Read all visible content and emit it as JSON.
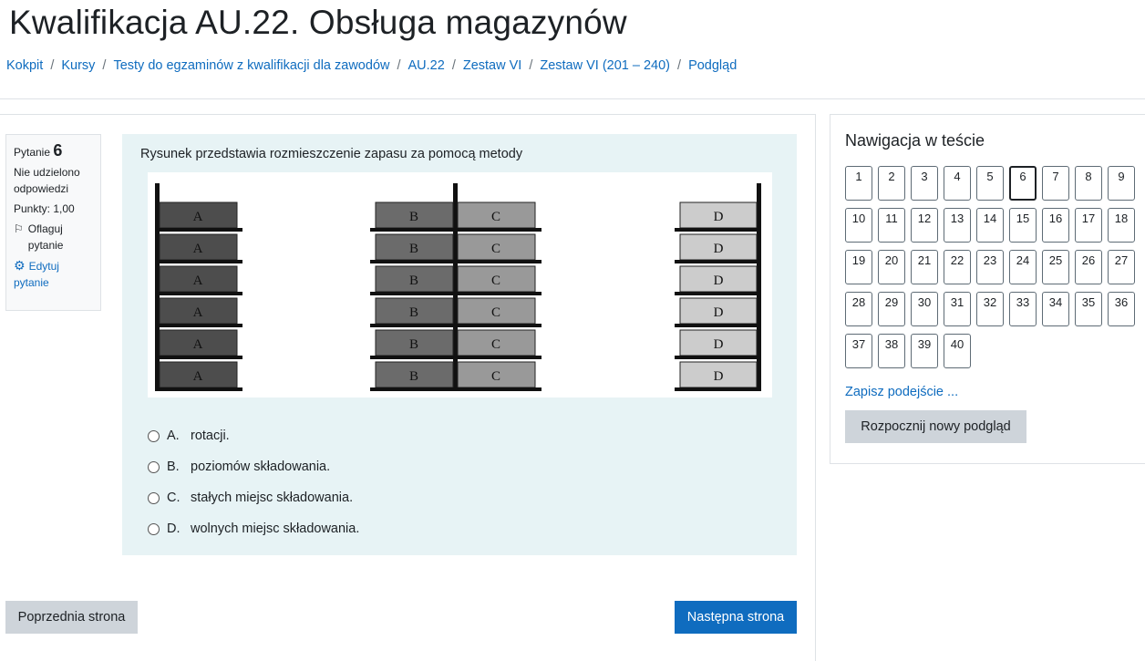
{
  "page": {
    "title": "Kwalifikacja AU.22. Obsługa magazynów"
  },
  "breadcrumb": [
    {
      "label": "Kokpit"
    },
    {
      "label": "Kursy"
    },
    {
      "label": "Testy do egzaminów z kwalifikacji dla zawodów"
    },
    {
      "label": "AU.22"
    },
    {
      "label": "Zestaw VI"
    },
    {
      "label": "Zestaw VI (201 – 240)"
    },
    {
      "label": "Podgląd"
    }
  ],
  "question_info": {
    "label": "Pytanie",
    "number": "6",
    "status": "Nie udzielono odpowiedzi",
    "points": "Punkty: 1,00",
    "flag_label": "Oflaguj pytanie",
    "edit_label": "Edytuj pytanie"
  },
  "question": {
    "text": "Rysunek przedstawia rozmieszczenie zapasu za pomocą metody",
    "image_labels": {
      "a": "A",
      "b": "B",
      "c": "C",
      "d": "D"
    },
    "image_colors": {
      "a": "#4d4d4d",
      "b": "#6b6b6b",
      "c": "#999999",
      "d": "#cccccc",
      "frame": "#111111"
    },
    "answers": [
      {
        "letter": "A.",
        "text": "rotacji."
      },
      {
        "letter": "B.",
        "text": "poziomów składowania."
      },
      {
        "letter": "C.",
        "text": "stałych miejsc składowania."
      },
      {
        "letter": "D.",
        "text": "wolnych miejsc składowania."
      }
    ]
  },
  "footer": {
    "prev_label": "Poprzednia strona",
    "next_label": "Następna strona"
  },
  "navigation": {
    "title": "Nawigacja w teście",
    "current": 6,
    "questions": [
      "1",
      "2",
      "3",
      "4",
      "5",
      "6",
      "7",
      "8",
      "9",
      "10",
      "11",
      "12",
      "13",
      "14",
      "15",
      "16",
      "17",
      "18",
      "19",
      "20",
      "21",
      "22",
      "23",
      "24",
      "25",
      "26",
      "27",
      "28",
      "29",
      "30",
      "31",
      "32",
      "33",
      "34",
      "35",
      "36",
      "37",
      "38",
      "39",
      "40"
    ],
    "finish_link": "Zapisz podejście ...",
    "restart_label": "Rozpocznij nowy podgląd"
  },
  "colors": {
    "link": "#0f6cbf",
    "primary_button": "#0f6cbf",
    "secondary_button": "#ced4da",
    "question_bg": "#e7f3f5"
  }
}
